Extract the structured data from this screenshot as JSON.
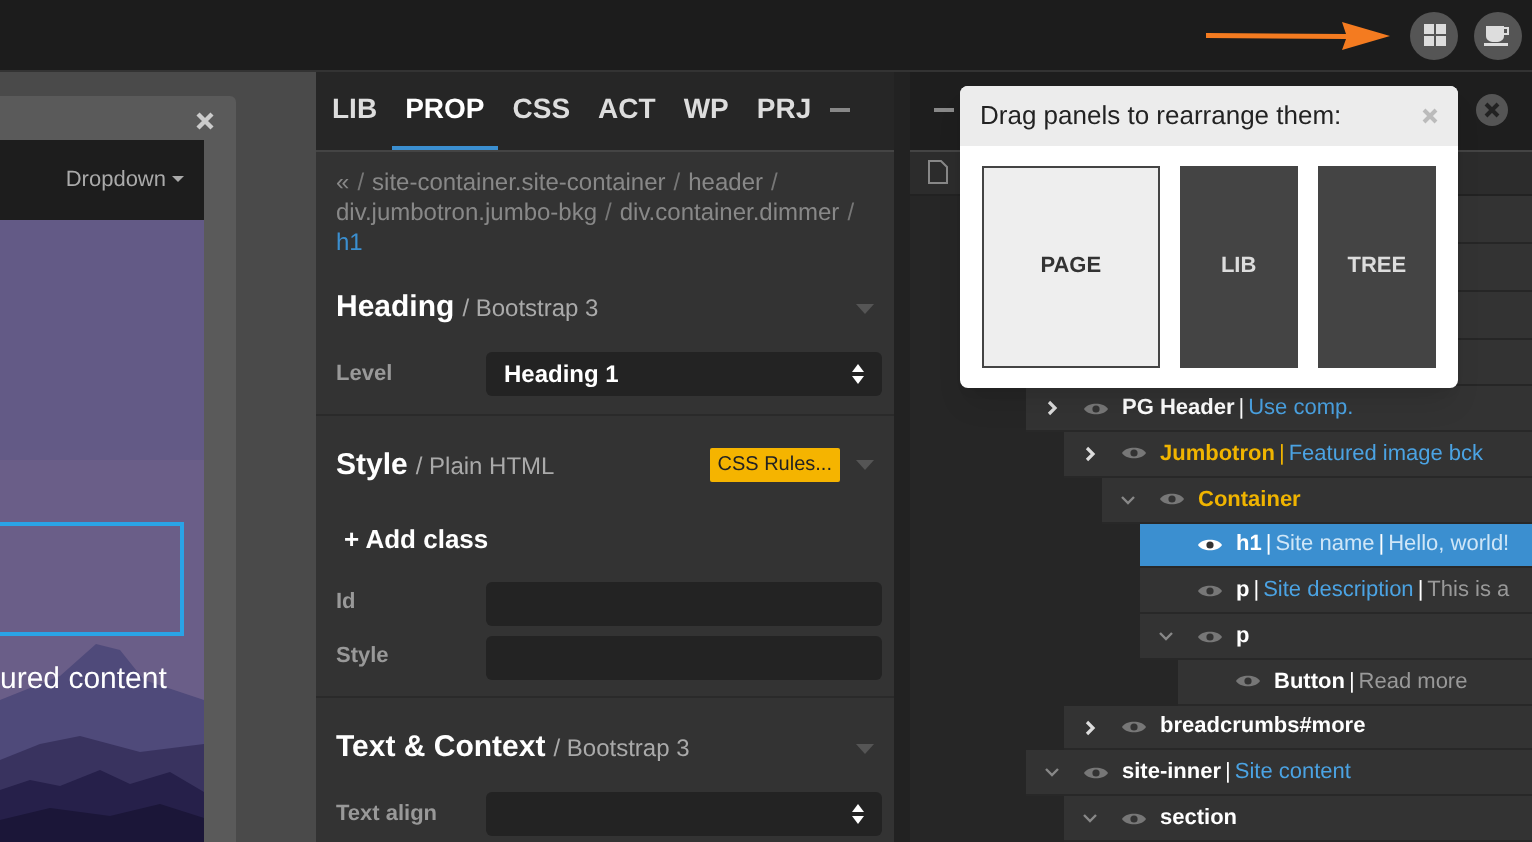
{
  "preview": {
    "nav_item": "Dropdown",
    "hero_text": "ured content"
  },
  "inspector": {
    "tabs": [
      {
        "label": "LIB",
        "selected": false
      },
      {
        "label": "PROP",
        "selected": true
      },
      {
        "label": "CSS",
        "selected": false
      },
      {
        "label": "ACT",
        "selected": false
      },
      {
        "label": "WP",
        "selected": false
      },
      {
        "label": "PRJ",
        "selected": false
      }
    ],
    "breadcrumb": {
      "separator": "/",
      "items": [
        {
          "label": "«",
          "selected": false
        },
        {
          "label": "site-container.site-container",
          "selected": false
        },
        {
          "label": "header",
          "selected": false
        },
        {
          "label": "div.jumbotron.jumbo-bkg",
          "selected": false
        },
        {
          "label": "div.container.dimmer",
          "selected": false
        },
        {
          "label": "h1",
          "selected": true
        }
      ]
    },
    "sections": [
      {
        "title": "Heading",
        "subtitle": "/ Bootstrap 3",
        "fields": [
          {
            "kind": "select",
            "label": "Level",
            "value": "Heading 1"
          }
        ]
      },
      {
        "title": "Style",
        "subtitle": "/ Plain HTML",
        "badge": "CSS Rules...",
        "fields": [
          {
            "kind": "button",
            "value": "+ Add class"
          },
          {
            "kind": "text",
            "label": "Id"
          },
          {
            "kind": "text",
            "label": "Style"
          }
        ]
      },
      {
        "title": "Text & Context",
        "subtitle": "/ Bootstrap 3",
        "fields": [
          {
            "kind": "select",
            "label": "Text align"
          }
        ]
      }
    ]
  },
  "tree": {
    "separator": "|",
    "rows": [
      {
        "name": "PG Header",
        "label": "Use comp.",
        "color": "#ffffff",
        "expanded": false,
        "children": [
          {
            "name": "Jumbotron",
            "label": "Featured image bck",
            "color": "#f0b400",
            "expanded": false,
            "children": [
              {
                "name": "Container",
                "color": "#f0b400",
                "expanded": true,
                "children": [
                  {
                    "name": "h1",
                    "label": "Site name",
                    "note": "Hello, world!",
                    "color": "#ffffff",
                    "selected": true
                  },
                  {
                    "name": "p",
                    "label": "Site description",
                    "note": "This is a",
                    "color": "#ffffff",
                    "selected": false
                  },
                  {
                    "name": "p",
                    "color": "#ffffff",
                    "expanded": true,
                    "children": [
                      {
                        "name": "Button",
                        "note": "Read more",
                        "color": "#ffffff",
                        "selected": false
                      }
                    ]
                  }
                ]
              }
            ]
          },
          {
            "name": "breadcrumbs#more",
            "color": "#ffffff",
            "expanded": false
          }
        ]
      },
      {
        "name": "site-inner",
        "label": "Site content",
        "color": "#ffffff",
        "expanded": true,
        "children": [
          {
            "name": "section",
            "color": "#ffffff",
            "expanded": true
          }
        ]
      }
    ]
  },
  "popover": {
    "title": "Drag panels to rearrange them:",
    "panels": [
      {
        "label": "PAGE",
        "selected": true
      },
      {
        "label": "LIB",
        "selected": false
      },
      {
        "label": "TREE",
        "selected": false
      }
    ]
  }
}
